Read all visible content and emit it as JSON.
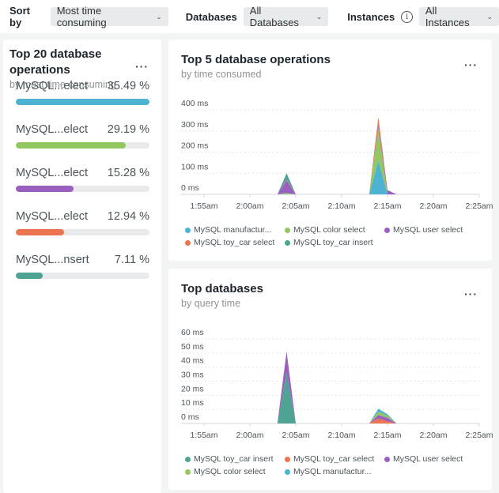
{
  "toolbar": {
    "sort_label": "Sort by",
    "sort_value": "Most time consuming",
    "databases_label": "Databases",
    "databases_value": "All Databases",
    "instances_label": "Instances",
    "instances_value": "All Instances",
    "info_icon": "i",
    "chevron": "⌄"
  },
  "ops_card": {
    "title_line1": "Top 20 database",
    "title_line2": "operations",
    "subtitle": "by most time consuming",
    "menu": "···",
    "items": [
      {
        "label": "MySQL...elect",
        "percent_text": "35.49 %",
        "fraction": 1.0,
        "color": "#4eb2d1"
      },
      {
        "label": "MySQL...elect",
        "percent_text": "29.19 %",
        "fraction": 0.82,
        "color": "#92c762"
      },
      {
        "label": "MySQL...elect",
        "percent_text": "15.28 %",
        "fraction": 0.43,
        "color": "#9b5fc0"
      },
      {
        "label": "MySQL...elect",
        "percent_text": "12.94 %",
        "fraction": 0.36,
        "color": "#ec7550"
      },
      {
        "label": "MySQL...nsert",
        "percent_text": "7.11 %",
        "fraction": 0.2,
        "color": "#4fa392"
      }
    ]
  },
  "top5_card": {
    "title": "Top 5 database operations",
    "subtitle": "by time consumed",
    "menu": "···",
    "legend": [
      [
        {
          "label": "MySQL manufactur...",
          "color": "#4eb2d1"
        },
        {
          "label": "MySQL color select",
          "color": "#92c762"
        },
        {
          "label": "MySQL user select",
          "color": "#9b5fc0"
        }
      ],
      [
        {
          "label": "MySQL toy_car select",
          "color": "#ec7550"
        },
        {
          "label": "MySQL toy_car insert",
          "color": "#4fa392"
        }
      ]
    ]
  },
  "topdb_card": {
    "title": "Top databases",
    "subtitle": "by query time",
    "menu": "···",
    "legend": [
      [
        {
          "label": "MySQL toy_car insert",
          "color": "#4fa392"
        },
        {
          "label": "MySQL toy_car select",
          "color": "#ec7550"
        },
        {
          "label": "MySQL user select",
          "color": "#9b5fc0"
        }
      ],
      [
        {
          "label": "MySQL color select",
          "color": "#92c762"
        },
        {
          "label": "MySQL manufactur...",
          "color": "#4eb2d1"
        }
      ]
    ]
  },
  "chart_data": [
    {
      "type": "area",
      "stacked": true,
      "title": "Top 5 database operations",
      "subtitle": "by time consumed",
      "xlabel": "",
      "ylabel": "",
      "x_ticks": [
        "1:55am",
        "2:00am",
        "2:05am",
        "2:10am",
        "2:15am",
        "2:20am",
        "2:25am"
      ],
      "y_ticks": [
        "0 ms",
        "100 ms",
        "200 ms",
        "300 ms",
        "400 ms"
      ],
      "ylim": [
        0,
        400
      ],
      "x_minutes": [
        0,
        8,
        9,
        10,
        18,
        19,
        20,
        21,
        40
      ],
      "series": [
        {
          "name": "MySQL manufactur...",
          "color": "#4eb2d1",
          "values": [
            0,
            0,
            2,
            0,
            0,
            160,
            0,
            0,
            0
          ]
        },
        {
          "name": "MySQL color select",
          "color": "#92c762",
          "values": [
            0,
            0,
            5,
            0,
            0,
            150,
            0,
            0,
            0
          ]
        },
        {
          "name": "MySQL user select",
          "color": "#9b5fc0",
          "values": [
            0,
            0,
            60,
            0,
            0,
            15,
            20,
            0,
            0
          ]
        },
        {
          "name": "MySQL toy_car select",
          "color": "#ec7550",
          "values": [
            0,
            0,
            3,
            0,
            0,
            40,
            0,
            0,
            0
          ]
        },
        {
          "name": "MySQL toy_car insert",
          "color": "#4fa392",
          "values": [
            0,
            0,
            30,
            0,
            0,
            0,
            0,
            0,
            0
          ]
        }
      ],
      "grid": true,
      "legend_position": "bottom"
    },
    {
      "type": "area",
      "stacked": true,
      "title": "Top databases",
      "subtitle": "by query time",
      "xlabel": "",
      "ylabel": "",
      "x_ticks": [
        "1:55am",
        "2:00am",
        "2:05am",
        "2:10am",
        "2:15am",
        "2:20am",
        "2:25am"
      ],
      "y_ticks": [
        "0 ms",
        "10 ms",
        "20 ms",
        "30 ms",
        "40 ms",
        "50 ms",
        "60 ms"
      ],
      "ylim": [
        0,
        60
      ],
      "x_minutes": [
        0,
        8,
        9,
        10,
        18,
        19,
        20,
        21,
        40
      ],
      "series": [
        {
          "name": "MySQL toy_car insert",
          "color": "#4fa392",
          "values": [
            0,
            0,
            36,
            0,
            0,
            0,
            0,
            0,
            0
          ]
        },
        {
          "name": "MySQL toy_car select",
          "color": "#ec7550",
          "values": [
            0,
            0,
            0,
            0,
            0,
            3.5,
            1.5,
            0,
            0
          ]
        },
        {
          "name": "MySQL user select",
          "color": "#9b5fc0",
          "values": [
            0,
            0,
            15,
            0,
            0,
            2.5,
            2.5,
            0,
            0
          ]
        },
        {
          "name": "MySQL color select",
          "color": "#92c762",
          "values": [
            0,
            0,
            0,
            0,
            0,
            2.5,
            1.5,
            0,
            0
          ]
        },
        {
          "name": "MySQL manufactur...",
          "color": "#4eb2d1",
          "values": [
            0,
            0,
            0,
            0,
            0,
            2,
            1,
            0,
            0
          ]
        }
      ],
      "grid": true,
      "legend_position": "bottom"
    }
  ]
}
